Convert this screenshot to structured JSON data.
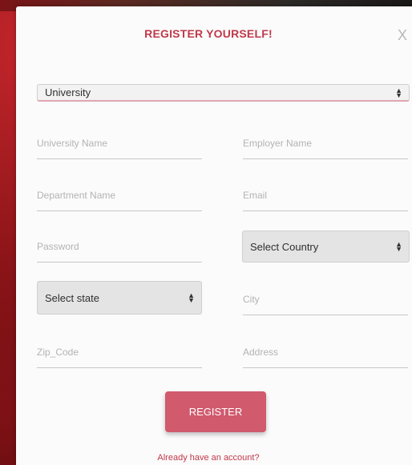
{
  "modal": {
    "title": "REGISTER YOURSELF!",
    "close_label": "X"
  },
  "form": {
    "type_select": {
      "value": "University",
      "options": [
        "University"
      ]
    },
    "university_name": {
      "placeholder": "University Name"
    },
    "employer_name": {
      "placeholder": "Employer Name"
    },
    "department_name": {
      "placeholder": "Department Name"
    },
    "email": {
      "placeholder": "Email"
    },
    "password": {
      "placeholder": "Password"
    },
    "country_select": {
      "value": "Select Country"
    },
    "state_select": {
      "value": "Select state"
    },
    "city": {
      "placeholder": "City"
    },
    "zip_code": {
      "placeholder": "Zip_Code"
    },
    "address": {
      "placeholder": "Address"
    },
    "register_label": "REGISTER",
    "login_link": "Already have an account?"
  },
  "icons": {
    "select_arrow": "updown-arrow-icon",
    "close": "close-icon"
  },
  "colors": {
    "accent": "#c0394b",
    "button": "#d15a6d",
    "background": "#8e1519"
  }
}
